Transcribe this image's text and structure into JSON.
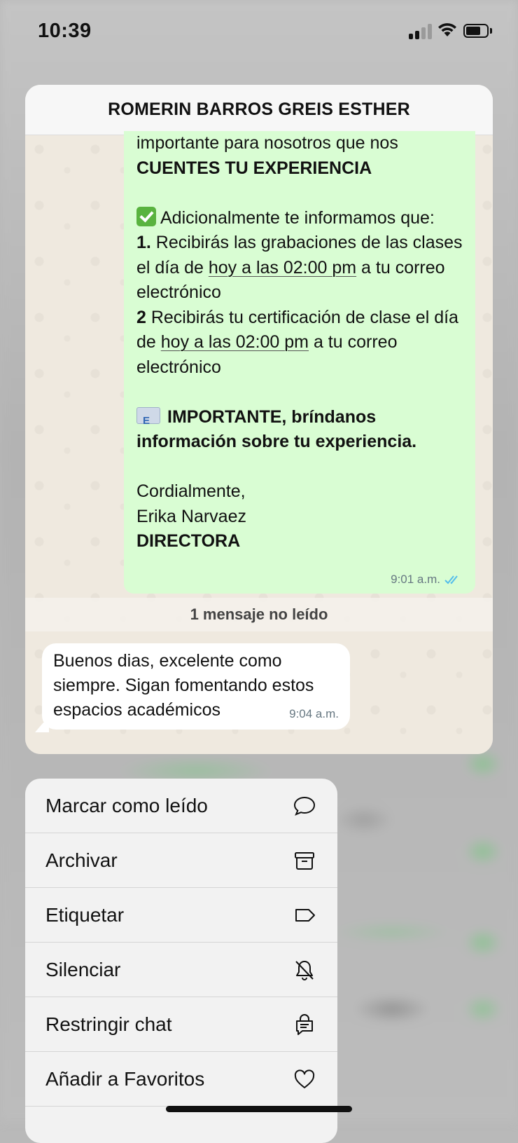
{
  "status_bar": {
    "time": "10:39"
  },
  "chat": {
    "title": "ROMERIN BARROS GREIS ESTHER",
    "outgoing": {
      "line1": "importante para nosotros que nos",
      "line2": "CUENTES TU EXPERIENCIA",
      "info_intro": "Adicionalmente te informamos que:",
      "item1_num": "1.",
      "item1_pre": " Recibirás las grabaciones de las clases el día de ",
      "item1_link": "hoy a las 02:00 pm",
      "item1_post": " a tu correo electrónico",
      "item2_num": "2",
      "item2_pre": " Recibirás tu certificación de clase el día de ",
      "item2_link": "hoy a las 02:00 pm",
      "item2_post": " a tu correo electrónico",
      "important": "IMPORTANTE, bríndanos información sobre tu experiencia.",
      "closing": "Cordialmente,",
      "signer": "Erika Narvaez",
      "role": "DIRECTORA",
      "time": "9:01 a.m."
    },
    "unread_banner": "1 mensaje no leído",
    "incoming": {
      "text": "Buenos dias, excelente como siempre. Sigan fomentando estos espacios académicos",
      "time": "9:04 a.m."
    }
  },
  "menu": {
    "items": [
      {
        "label": "Marcar como leído",
        "icon": "chat-bubble-icon"
      },
      {
        "label": "Archivar",
        "icon": "archive-icon"
      },
      {
        "label": "Etiquetar",
        "icon": "tag-icon"
      },
      {
        "label": "Silenciar",
        "icon": "bell-slash-icon"
      },
      {
        "label": "Restringir chat",
        "icon": "lock-chat-icon"
      },
      {
        "label": "Añadir a Favoritos",
        "icon": "heart-icon"
      }
    ]
  },
  "colors": {
    "outgoing_bubble": "#d9fdd3",
    "incoming_bubble": "#ffffff",
    "read_ticks": "#53bdeb",
    "chat_background": "#efe9df"
  }
}
